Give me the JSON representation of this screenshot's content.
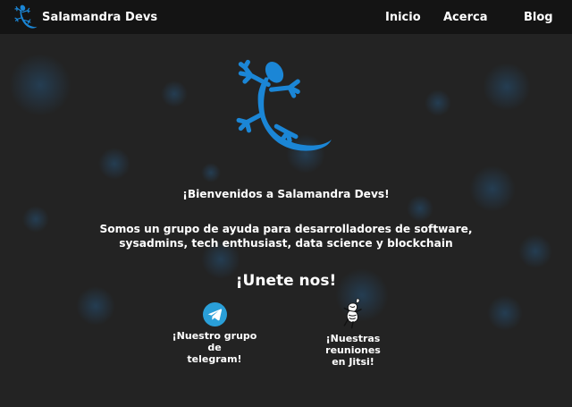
{
  "brand": {
    "name": "Salamandra Devs",
    "logo_icon": "salamander-icon"
  },
  "nav": {
    "items": [
      {
        "label": "Inicio"
      },
      {
        "label": "Acerca"
      },
      {
        "label": "Blog"
      }
    ]
  },
  "hero": {
    "logo_icon": "salamander-icon",
    "welcome": "¡Bienvenidos a Salamandra Devs!",
    "about_line1": "Somos un grupo de ayuda para desarrolladores de software,",
    "about_line2": "sysadmins, tech enthusiast, data science y blockchain",
    "join_title": "¡Unete nos!"
  },
  "links": {
    "telegram": {
      "icon": "telegram-icon",
      "line1": "¡Nuestro grupo de",
      "line2": "telegram!"
    },
    "jitsi": {
      "icon": "jitsi-icon",
      "line1": "¡Nuestras reuniones",
      "line2": "en Jitsi!"
    }
  },
  "colors": {
    "background": "#232323",
    "navbar": "#141414",
    "accent": "#1b86d6",
    "telegram": "#2a9fd8"
  }
}
